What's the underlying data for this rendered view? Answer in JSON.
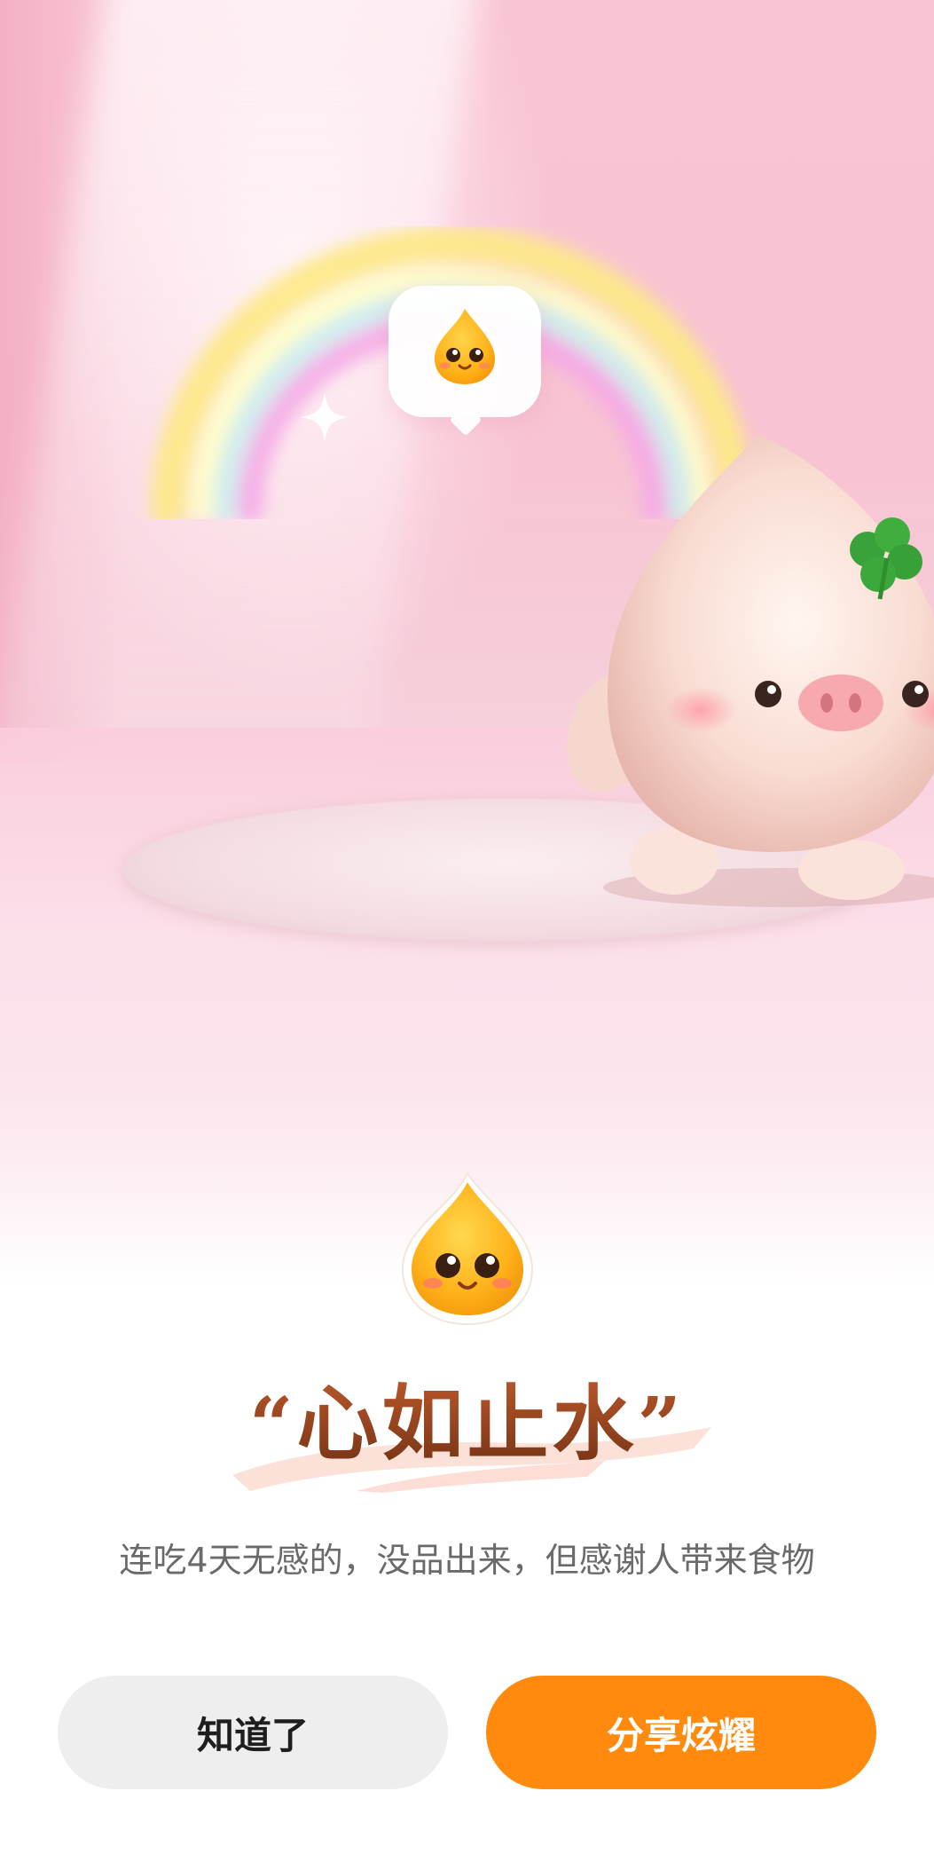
{
  "scene": {
    "bubble_icon": "smiling-droplet-icon",
    "sparkle_icon": "sparkle-icon",
    "character": "pink-bun-mascot-with-clover"
  },
  "result": {
    "mood_icon": "smiling-droplet-icon",
    "quote_open": "“",
    "title": "心如止水",
    "quote_close": "”",
    "description": "连吃4天无感的，没品出来，但感谢人带来食物"
  },
  "buttons": {
    "know_label": "知道了",
    "share_label": "分享炫耀"
  },
  "colors": {
    "share_button": "#ff8a0e",
    "know_button": "#eeeeee",
    "title_gradient_top": "#c05a2c",
    "title_gradient_bottom": "#6b2e12",
    "background_pink": "#f8c3d2"
  }
}
